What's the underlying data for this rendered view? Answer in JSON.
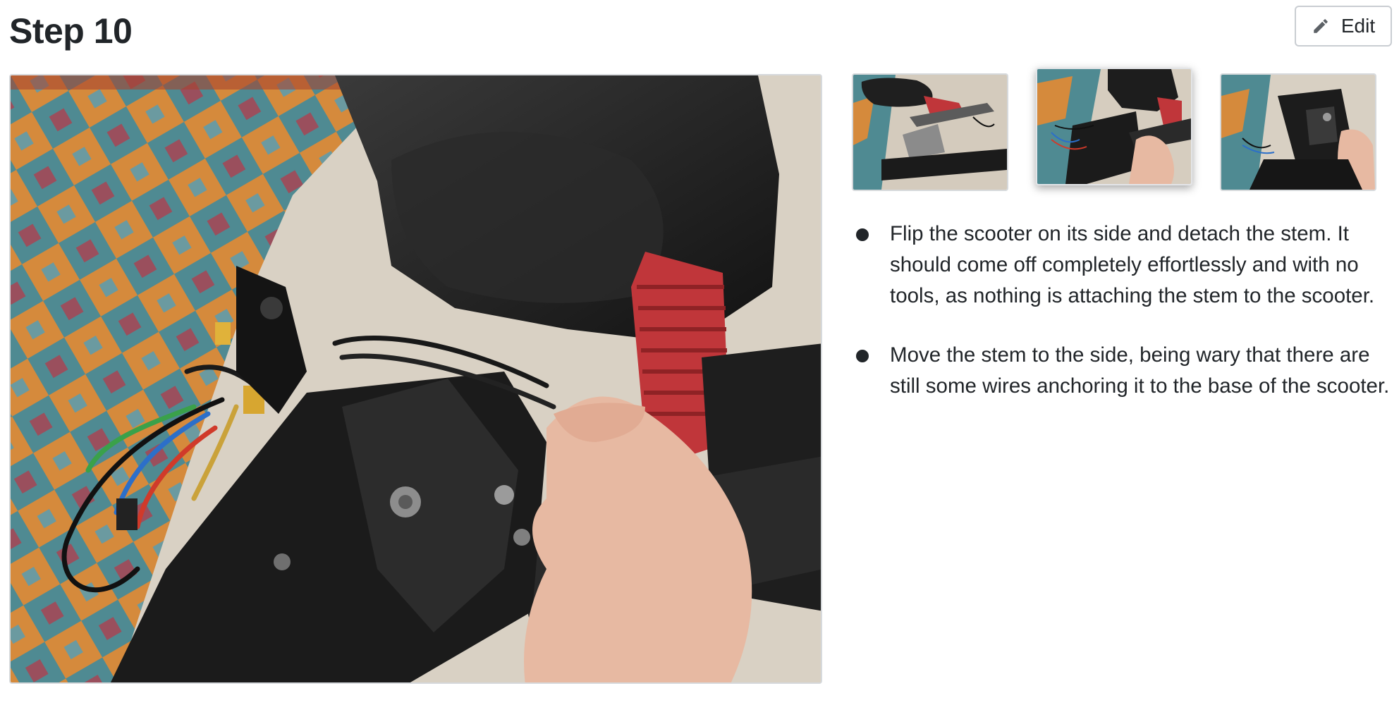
{
  "step": {
    "title": "Step 10"
  },
  "toolbar": {
    "edit_label": "Edit",
    "edit_icon": "pencil-icon"
  },
  "media": {
    "main_image": "scooter-stem-being-detached-photo",
    "thumbnails": [
      {
        "image": "scooter-on-rug-thumbnail",
        "selected": false
      },
      {
        "image": "stem-detach-thumbnail",
        "selected": true
      },
      {
        "image": "stem-base-thumbnail",
        "selected": false
      }
    ]
  },
  "instructions": [
    {
      "text": "Flip the scooter on its side and detach the stem. It should come off completely effortlessly and with no tools, as nothing is attaching the stem to the scooter."
    },
    {
      "text": "Move the stem to the side, being wary that there are still some wires anchoring it to the base of the scooter."
    }
  ],
  "colors": {
    "text": "#212529",
    "border": "#d6d9dc",
    "accent_red": "#c0363a"
  }
}
